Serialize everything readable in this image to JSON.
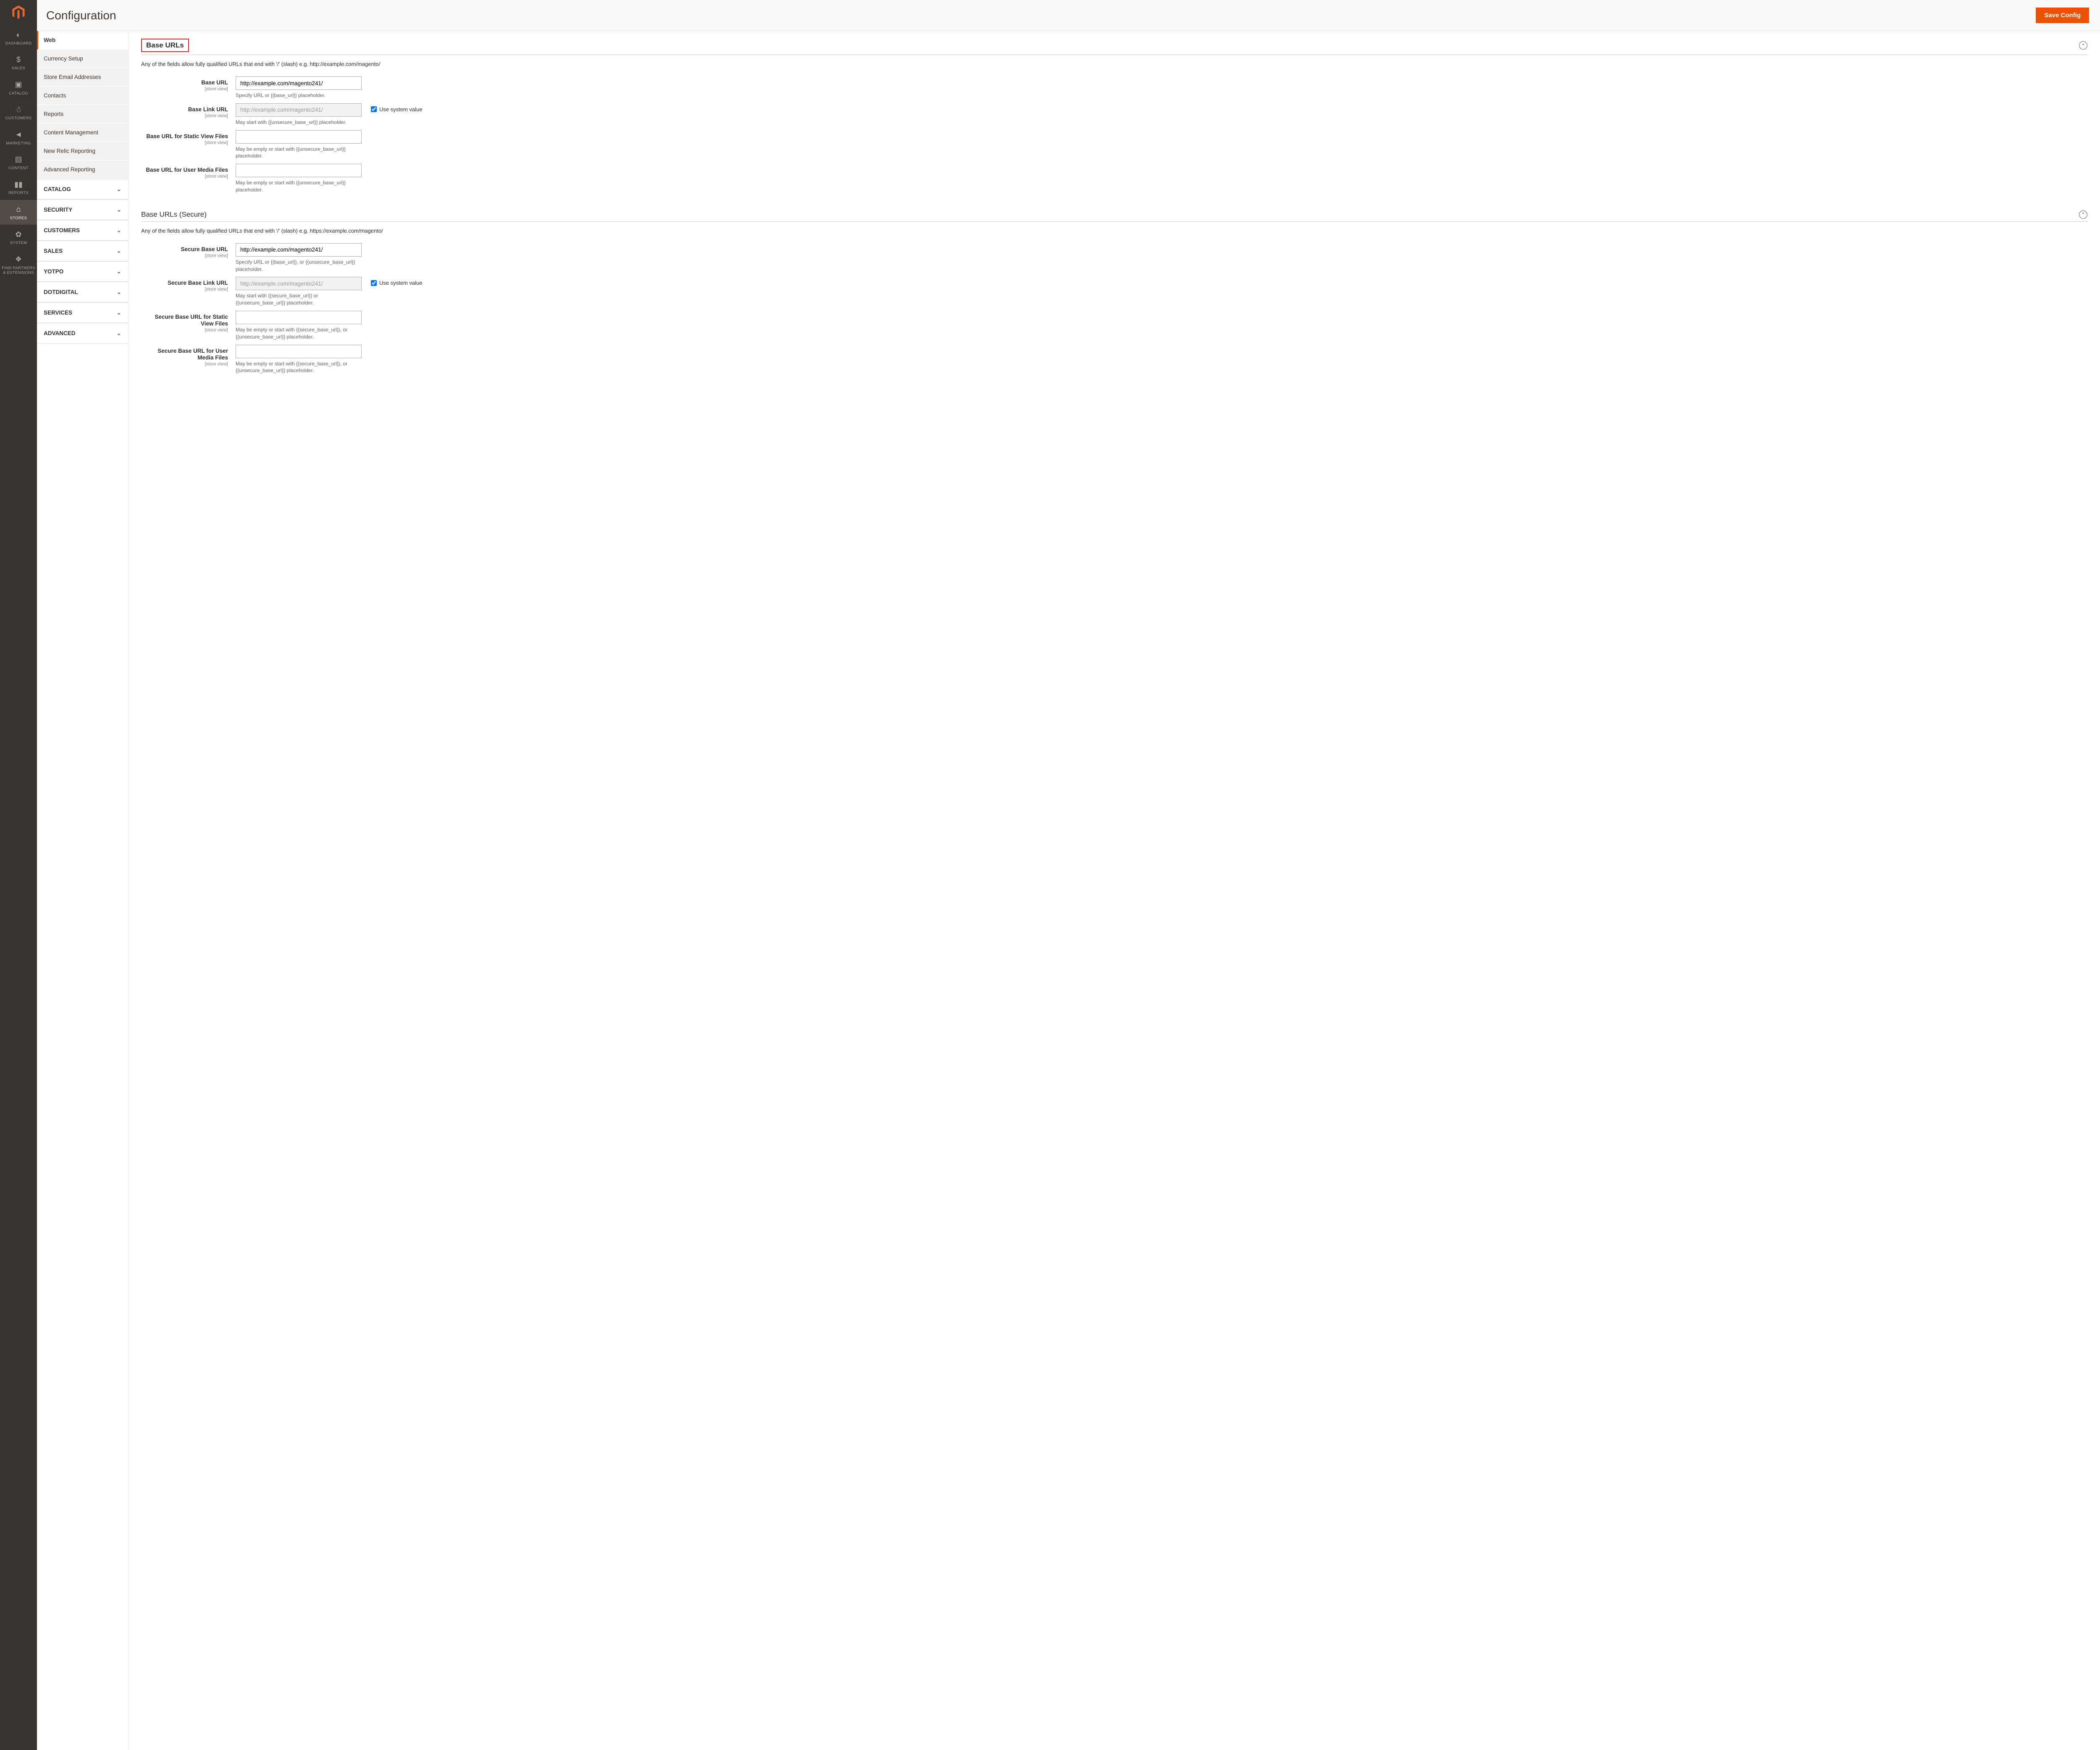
{
  "colors": {
    "accent": "#eb5202",
    "dark_nav": "#373330",
    "highlight_border": "#e22626"
  },
  "page": {
    "title": "Configuration",
    "save_button": "Save Config"
  },
  "admin_nav": {
    "items": [
      {
        "label": "DASHBOARD",
        "icon": "dashboard-icon"
      },
      {
        "label": "SALES",
        "icon": "dollar-icon"
      },
      {
        "label": "CATALOG",
        "icon": "box-icon"
      },
      {
        "label": "CUSTOMERS",
        "icon": "person-icon"
      },
      {
        "label": "MARKETING",
        "icon": "megaphone-icon"
      },
      {
        "label": "CONTENT",
        "icon": "layout-icon"
      },
      {
        "label": "REPORTS",
        "icon": "bars-icon"
      },
      {
        "label": "STORES",
        "icon": "storefront-icon",
        "active": true
      },
      {
        "label": "SYSTEM",
        "icon": "gear-icon"
      },
      {
        "label": "FIND PARTNERS & EXTENSIONS",
        "icon": "partners-icon"
      }
    ]
  },
  "config_nav": {
    "sub_items": [
      {
        "label": "Web",
        "active": true
      },
      {
        "label": "Currency Setup"
      },
      {
        "label": "Store Email Addresses"
      },
      {
        "label": "Contacts"
      },
      {
        "label": "Reports"
      },
      {
        "label": "Content Management"
      },
      {
        "label": "New Relic Reporting"
      },
      {
        "label": "Advanced Reporting"
      }
    ],
    "sections": [
      {
        "label": "CATALOG"
      },
      {
        "label": "SECURITY"
      },
      {
        "label": "CUSTOMERS"
      },
      {
        "label": "SALES"
      },
      {
        "label": "YOTPO"
      },
      {
        "label": "DOTDIGITAL"
      },
      {
        "label": "SERVICES"
      },
      {
        "label": "ADVANCED"
      }
    ]
  },
  "labels": {
    "scope": "[store view]",
    "use_system_value": "Use system value"
  },
  "form": {
    "base_urls": {
      "title": "Base URLs",
      "note": "Any of the fields allow fully qualified URLs that end with '/' (slash) e.g. http://example.com/magento/",
      "fields": {
        "base_url": {
          "label": "Base URL",
          "value": "http://example.com/magento241/",
          "help": "Specify URL or {{base_url}} placeholder."
        },
        "base_link_url": {
          "label": "Base Link URL",
          "value": "http://example.com/magento241/",
          "help": "May start with {{unsecure_base_url}} placeholder.",
          "use_system": true
        },
        "static": {
          "label": "Base URL for Static View Files",
          "value": "",
          "help": "May be empty or start with {{unsecure_base_url}} placeholder."
        },
        "media": {
          "label": "Base URL for User Media Files",
          "value": "",
          "help": "May be empty or start with {{unsecure_base_url}} placeholder."
        }
      }
    },
    "base_urls_secure": {
      "title": "Base URLs (Secure)",
      "note": "Any of the fields allow fully qualified URLs that end with '/' (slash) e.g. https://example.com/magento/",
      "fields": {
        "secure_base_url": {
          "label": "Secure Base URL",
          "value": "http://example.com/magento241/",
          "help": "Specify URL or {{base_url}}, or {{unsecure_base_url}} placeholder."
        },
        "secure_base_link_url": {
          "label": "Secure Base Link URL",
          "value": "http://example.com/magento241/",
          "help": "May start with {{secure_base_url}} or {{unsecure_base_url}} placeholder.",
          "use_system": true
        },
        "secure_static": {
          "label": "Secure Base URL for Static View Files",
          "value": "",
          "help": "May be empty or start with {{secure_base_url}}, or {{unsecure_base_url}} placeholder."
        },
        "secure_media": {
          "label": "Secure Base URL for User Media Files",
          "value": "",
          "help": "May be empty or start with {{secure_base_url}}, or {{unsecure_base_url}} placeholder."
        }
      }
    }
  }
}
